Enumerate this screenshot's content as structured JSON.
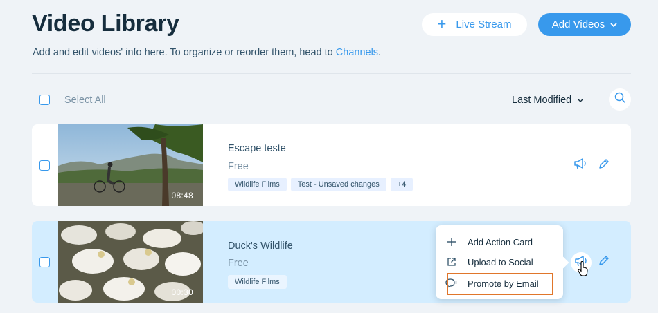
{
  "header": {
    "title": "Video Library",
    "subtitle_prefix": "Add and edit videos' info here. To organize or reorder them, head to ",
    "subtitle_link": "Channels",
    "subtitle_suffix": ".",
    "live_stream_label": "Live Stream",
    "add_videos_label": "Add Videos"
  },
  "toolbar": {
    "select_all_label": "Select All",
    "sort_label": "Last Modified"
  },
  "videos": [
    {
      "title": "Escape teste",
      "price": "Free",
      "duration": "08:48",
      "tags": [
        "Wildlife Films",
        "Test - Unsaved changes",
        "+4"
      ]
    },
    {
      "title": "Duck's Wildlife",
      "price": "Free",
      "duration": "00:30",
      "tags": [
        "Wildlife Films"
      ]
    }
  ],
  "promote_menu": {
    "items": [
      {
        "label": "Add Action Card",
        "icon": "plus-icon"
      },
      {
        "label": "Upload to Social",
        "icon": "external-link-icon"
      },
      {
        "label": "Promote by Email",
        "icon": "chat-bubble-icon"
      }
    ]
  },
  "colors": {
    "accent": "#3899ec",
    "title": "#162d3d",
    "highlight_row": "#d3edff",
    "menu_highlight_border": "#e0762b"
  }
}
